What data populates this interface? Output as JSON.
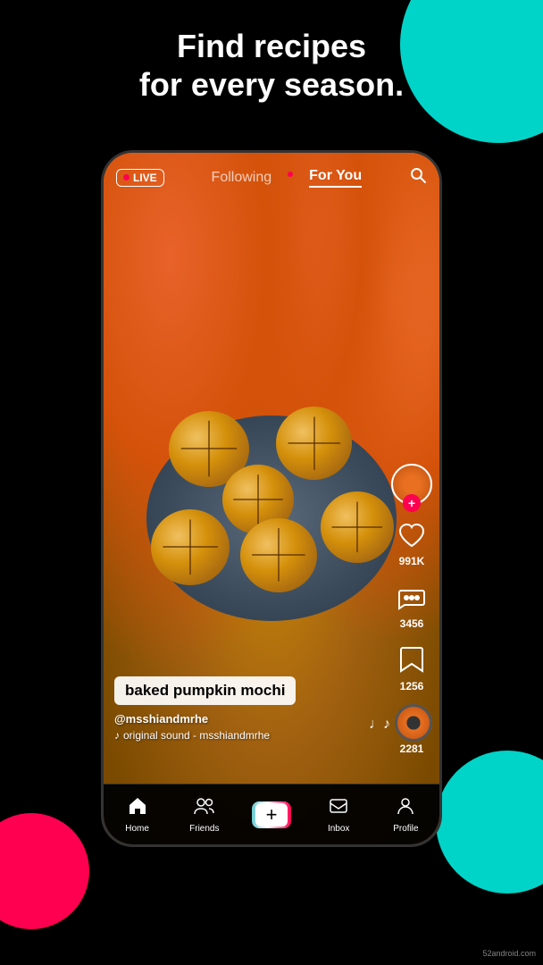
{
  "background": {
    "color": "#000000",
    "teal": "#00d4c8",
    "pink": "#ff0050"
  },
  "header": {
    "line1": "Find recipes",
    "line2": "for every season."
  },
  "top_bar": {
    "live_label": "LIVE",
    "following_tab": "Following",
    "for_you_tab": "For You",
    "search_label": "search"
  },
  "video": {
    "caption": "baked pumpkin mochi",
    "username": "@msshiandmrhe",
    "sound": "original sound - msshiandmrhe"
  },
  "actions": {
    "likes": "991K",
    "comments": "3456",
    "saves": "1256",
    "shares": "2281"
  },
  "bottom_nav": {
    "items": [
      {
        "label": "Home",
        "icon": "🏠"
      },
      {
        "label": "Friends",
        "icon": "👥"
      },
      {
        "label": "+",
        "icon": "+"
      },
      {
        "label": "Inbox",
        "icon": "💬"
      },
      {
        "label": "Profile",
        "icon": "👤"
      }
    ]
  },
  "watermark": "52android.com"
}
